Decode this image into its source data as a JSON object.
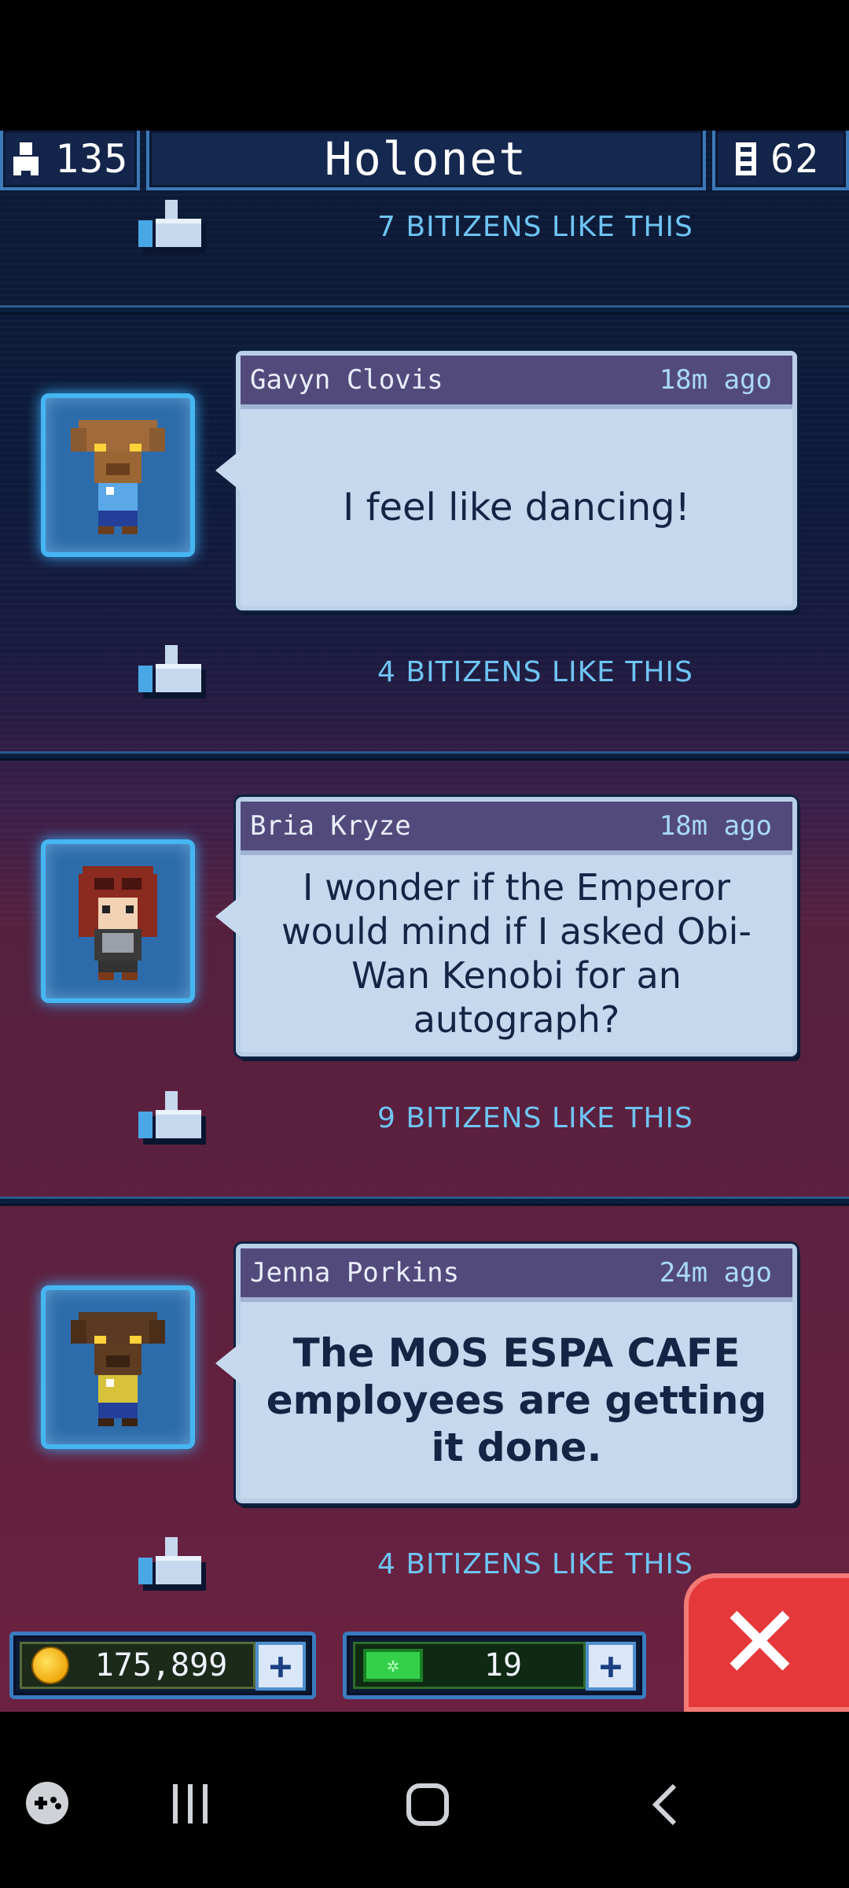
{
  "header": {
    "population": "135",
    "title": "Holonet",
    "floors": "62"
  },
  "posts": [
    {
      "likes": "7 BITIZENS LIKE THIS"
    },
    {
      "author": "Gavyn Clovis",
      "time": "18m ago",
      "message": "I feel like dancing!",
      "likes": "4 BITIZENS LIKE THIS"
    },
    {
      "author": "Bria Kryze",
      "time": "18m ago",
      "message": "I wonder if the Emperor would mind if I asked Obi-Wan Kenobi for an autograph?",
      "likes": "9 BITIZENS LIKE THIS"
    },
    {
      "author": "Jenna Porkins",
      "time": "24m ago",
      "message": "The MOS ESPA CAFE employees are getting it done.",
      "likes": "4 BITIZENS LIKE THIS"
    }
  ],
  "bottom_bar": {
    "coins": "175,899",
    "bux": "19",
    "plus": "+",
    "close": "✕"
  },
  "icons": {
    "population": "person-icon",
    "floors": "building-icon",
    "like": "thumbs-up-icon",
    "coin": "coin-icon",
    "bux": "bux-icon",
    "game_launcher": "gamepad-icon",
    "recents": "recents-icon",
    "home": "home-icon",
    "back": "back-icon"
  }
}
